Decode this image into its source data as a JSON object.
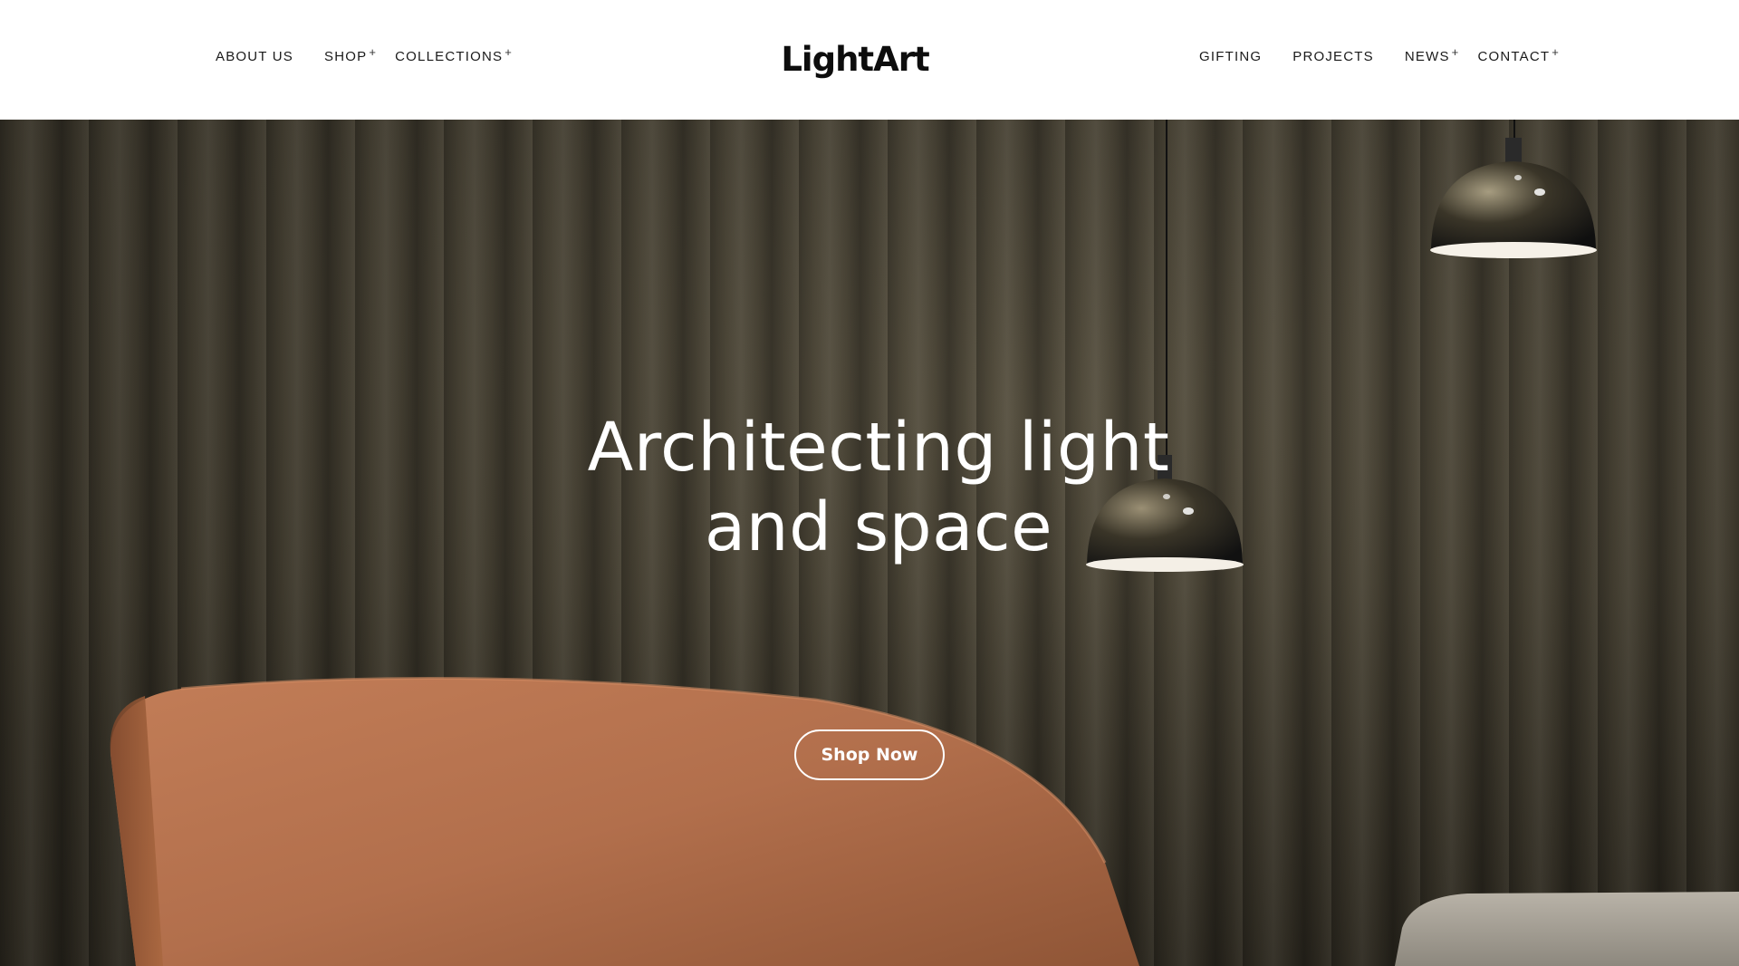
{
  "brand": {
    "logo_text": "LightArt"
  },
  "nav": {
    "left": [
      {
        "label": "ABOUT US",
        "has_submenu": false
      },
      {
        "label": "SHOP",
        "has_submenu": true
      },
      {
        "label": "COLLECTIONS",
        "has_submenu": true
      }
    ],
    "right": [
      {
        "label": "GIFTING",
        "has_submenu": false
      },
      {
        "label": "PROJECTS",
        "has_submenu": false
      },
      {
        "label": "NEWS",
        "has_submenu": true
      },
      {
        "label": "CONTACT",
        "has_submenu": true
      }
    ],
    "submenu_indicator": "+"
  },
  "hero": {
    "title_line1": "Architecting light",
    "title_line2": "and space",
    "cta_label": "Shop Now"
  },
  "colors": {
    "header_bg": "#ffffff",
    "text_dark": "#1a1a1a",
    "curtain": "#4b4536",
    "chair": "#b26f4c",
    "hero_text": "#ffffff"
  }
}
